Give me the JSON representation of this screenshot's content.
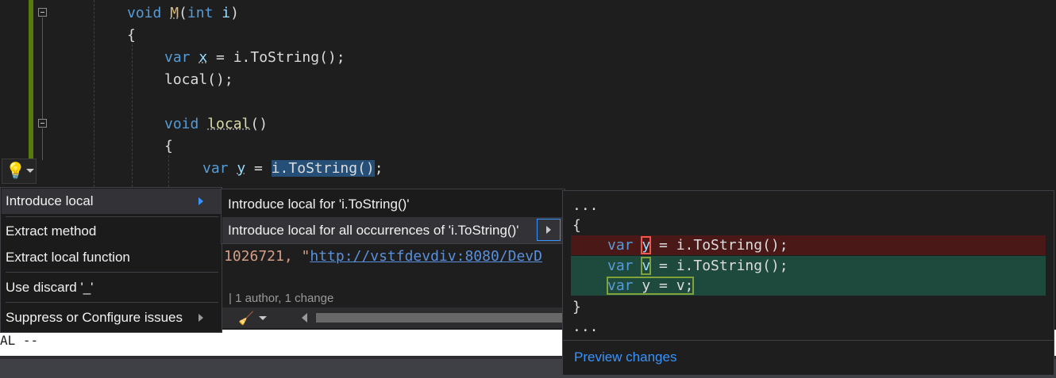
{
  "editor": {
    "lines": [
      {
        "kw": "void",
        "name": "M",
        "open": "(",
        "param_type": "int",
        "param_name": "i",
        "close": ")"
      },
      {
        "text": "{"
      },
      {
        "kw": "var",
        "name": "x",
        "rest": " = i.ToString();"
      },
      {
        "text": "local();"
      },
      {
        "kw": "void",
        "name": "local",
        "rest": "()"
      },
      {
        "text": "{"
      },
      {
        "kw": "var",
        "name": "y",
        "eq": " = ",
        "selected": "i.ToString()",
        "tail": ";"
      }
    ],
    "string_prefix": "1026721, \"",
    "string_url": "http://vstfdevdiv:8080/DevD",
    "codelens": "| 1 author, 1 change"
  },
  "lightbulb": {
    "icon": "lightbulb-icon"
  },
  "context_menu": {
    "items": [
      {
        "label": "Introduce local",
        "has_submenu": true
      },
      {
        "label": "Extract method"
      },
      {
        "label": "Extract local function"
      },
      {
        "label": "Use discard '_'"
      },
      {
        "label": "Suppress or Configure issues",
        "has_submenu": true
      }
    ]
  },
  "submenu": {
    "items": [
      {
        "label": "Introduce local for 'i.ToString()'"
      },
      {
        "label": "Introduce local for all occurrences of 'i.ToString()'"
      }
    ]
  },
  "preview": {
    "ellipsis_top": "...",
    "open_brace": "{",
    "removed": {
      "kw": "var",
      "name": "y",
      "rest": " = i.ToString();"
    },
    "added1": {
      "kw": "var",
      "name": "v",
      "rest": " = i.ToString();"
    },
    "added2": {
      "kw": "var",
      "eq": " y = v;"
    },
    "close_brace": "}",
    "ellipsis_bottom": "...",
    "link": "Preview changes"
  },
  "output": {
    "text": "AL --"
  },
  "colors": {
    "accent": "#3794ff",
    "removed_bg": "#4b1818",
    "added_bg": "#1e4a3d",
    "lightbulb": "#ffcc00"
  }
}
